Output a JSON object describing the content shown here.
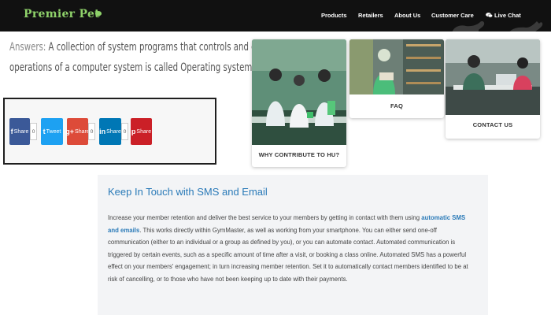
{
  "colors": {
    "header_bg": "#111111",
    "brand_green": "#8fd26a",
    "link_blue": "#2a7ab8"
  },
  "header": {
    "logo": "Premier Pet",
    "nav": [
      "Products",
      "Retailers",
      "About Us",
      "Customer Care"
    ],
    "live_chat": "Live Chat",
    "chat_icon": "speech-bubble-icon"
  },
  "quiz": {
    "prefix": "Answers:",
    "line1": "A collection of system programs that controls and co-ordinates the overall",
    "line2": "operations of a computer system is called Operating system."
  },
  "share": {
    "facebook": {
      "icon": "f",
      "label": "Share",
      "count": "0"
    },
    "twitter": {
      "icon": "t",
      "label": "Tweet"
    },
    "google": {
      "icon": "g+",
      "label": "Share",
      "count": "0"
    },
    "linkedin": {
      "icon": "in",
      "label": "Share",
      "count": "0"
    },
    "pinterest": {
      "icon": "p",
      "label": "Share"
    }
  },
  "cards": [
    {
      "label": "WHY CONTRIBUTE TO HU?",
      "image": "lab-students-photo"
    },
    {
      "label": "FAQ",
      "image": "library-student-photo"
    },
    {
      "label": "CONTACT US",
      "image": "study-area-photo"
    }
  ],
  "content": {
    "title": "Keep In Touch with SMS and Email",
    "body_before": "Increase your member retention and deliver the best service to your members by getting in contact with them using ",
    "link": "automatic SMS and emails",
    "body_after": ". This works directly within GymMaster, as well as working from your smartphone. You can either send one-off communication (either to an individual or a group as defined by you), or you can automate contact. Automated communication is triggered by certain events, such as a specific amount of time after a visit, or booking a class online. Automated SMS has a powerful effect on your members' engagement; in turn increasing member retention. Set it to automatically contact members identified to be at risk of cancelling, or to those who have not been keeping up to date with their payments."
  }
}
